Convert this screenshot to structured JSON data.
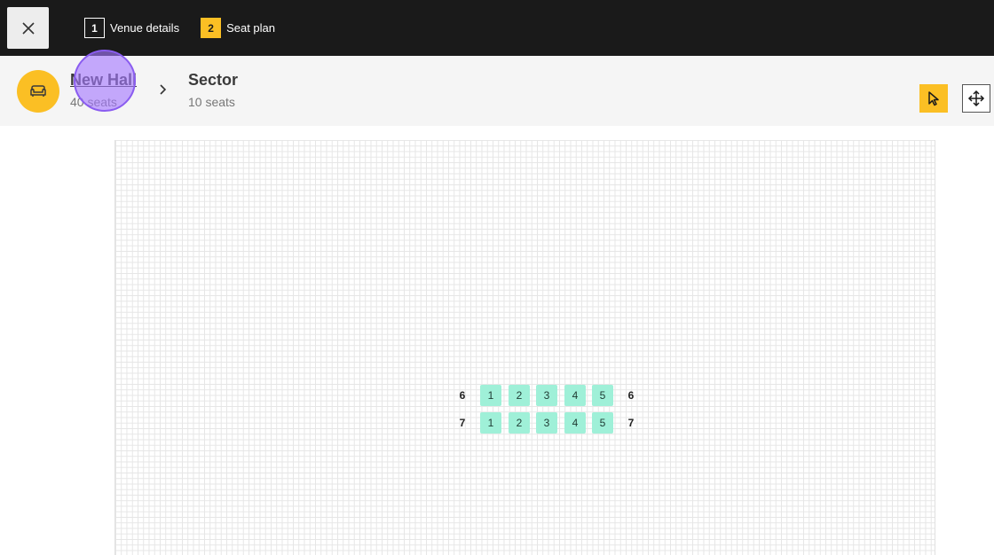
{
  "topbar": {
    "close_icon": "close-icon",
    "steps": [
      {
        "number": "1",
        "label": "Venue details",
        "state": "done"
      },
      {
        "number": "2",
        "label": "Seat plan",
        "state": "active"
      }
    ],
    "accent_color": "#fbbf24"
  },
  "breadcrumb": {
    "venue_icon": "sofa-icon",
    "venue": {
      "title": "New Hall",
      "subtitle": "40 seats"
    },
    "separator_icon": "chevron-right-icon",
    "sector": {
      "title": "Sector",
      "subtitle": "10 seats"
    }
  },
  "tools": {
    "select_icon": "pointer-icon",
    "move_icon": "move-arrows-icon",
    "active_tool": "select"
  },
  "seat_plan": {
    "seat_color": "#9ff0d8",
    "rows": [
      {
        "label": "6",
        "seats": [
          "1",
          "2",
          "3",
          "4",
          "5"
        ]
      },
      {
        "label": "7",
        "seats": [
          "1",
          "2",
          "3",
          "4",
          "5"
        ]
      }
    ]
  }
}
